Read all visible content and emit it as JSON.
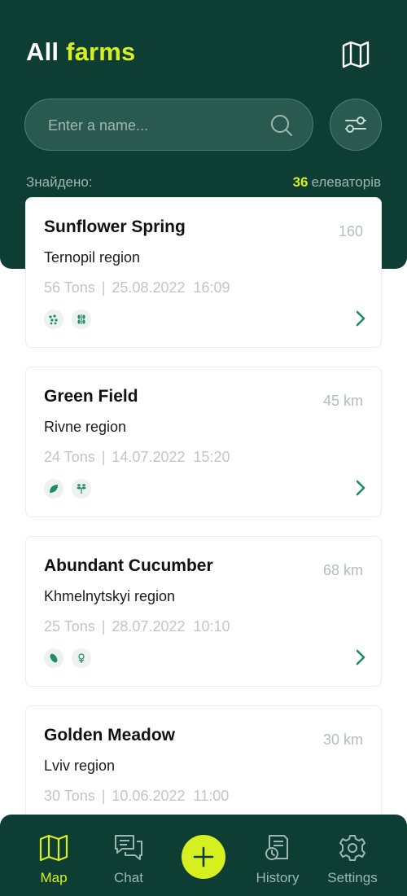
{
  "header": {
    "title_part1": "All",
    "title_part2": "farms",
    "map_icon": "map-icon"
  },
  "search": {
    "placeholder": "Enter a name...",
    "value": ""
  },
  "results": {
    "found_label": "Знайдено:",
    "count": "36",
    "count_suffix": "елеваторів"
  },
  "farms": [
    {
      "name": "Sunflower Spring",
      "distance": "160",
      "region": "Ternopil region",
      "tons": "56 Tons",
      "separator": "|",
      "date": "25.08.2022",
      "time": "16:09",
      "crops": [
        "seeds-icon",
        "wheat-icon"
      ]
    },
    {
      "name": "Green Field",
      "distance": "45 km",
      "region": "Rivne region",
      "tons": "24 Tons",
      "separator": "|",
      "date": "14.07.2022",
      "time": "15:20",
      "crops": [
        "leaf-icon",
        "herb-icon"
      ]
    },
    {
      "name": "Abundant Cucumber",
      "distance": "68 km",
      "region": "Khmelnytskyi region",
      "tons": "25 Tons",
      "separator": "|",
      "date": "28.07.2022",
      "time": "10:10",
      "crops": [
        "cucumber-icon",
        "flower-icon"
      ]
    },
    {
      "name": "Golden Meadow",
      "distance": "30 km",
      "region": "Lviv region",
      "tons": "30 Tons",
      "separator": "|",
      "date": "10.06.2022",
      "time": "11:00",
      "crops": []
    }
  ],
  "nav": {
    "map": "Map",
    "chat": "Chat",
    "history": "History",
    "settings": "Settings"
  },
  "colors": {
    "primary_dark": "#0d3d33",
    "accent": "#d6f01f",
    "icon_green": "#1f8a6e"
  }
}
